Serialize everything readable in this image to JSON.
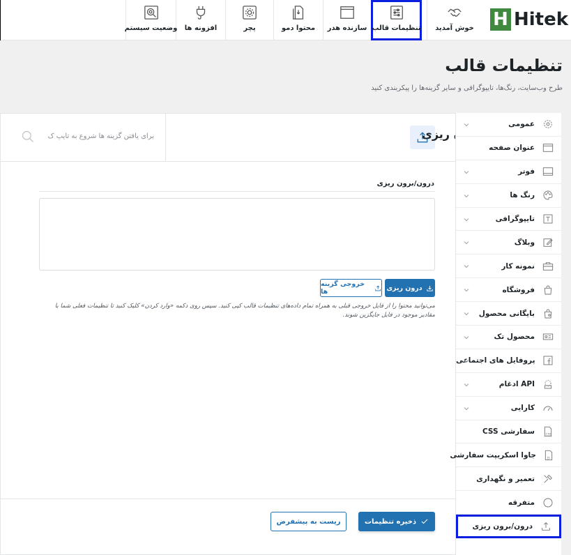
{
  "brand": {
    "name": "Hitek",
    "mark": "H",
    "color": "#3f8a3f"
  },
  "tabs": [
    {
      "label": "خوش آمدید",
      "icon": "handshake-icon"
    },
    {
      "label": "تنظیمات قالب",
      "icon": "sliders-icon",
      "active": true
    },
    {
      "label": "سازنده هدر",
      "icon": "layout-icon"
    },
    {
      "label": "محتوا دمو",
      "icon": "document-icon"
    },
    {
      "label": "پچر",
      "icon": "gear-box-icon"
    },
    {
      "label": "افزونه ها",
      "icon": "plug-icon"
    },
    {
      "label": "وضعیت سیستم",
      "icon": "search-gear-icon"
    }
  ],
  "page": {
    "title": "تنظیمات قالب",
    "description": "طرح وب‌سایت، رنگ‌ها، تایپوگرافی و سایر گزینه‌ها را پیکربندی کنید"
  },
  "sidebar": {
    "items": [
      {
        "label": "عمومی",
        "icon": "gear-icon",
        "has_children": true
      },
      {
        "label": "عنوان صفحه",
        "icon": "window-icon",
        "has_children": false
      },
      {
        "label": "فوتر",
        "icon": "footer-icon",
        "has_children": true
      },
      {
        "label": "رنگ ها",
        "icon": "palette-icon",
        "has_children": true
      },
      {
        "label": "تایپوگرافی",
        "icon": "typography-icon",
        "has_children": true
      },
      {
        "label": "وبلاگ",
        "icon": "edit-icon",
        "has_children": true
      },
      {
        "label": "نمونه کار",
        "icon": "briefcase-icon",
        "has_children": true
      },
      {
        "label": "فروشگاه",
        "icon": "bag-icon",
        "has_children": true
      },
      {
        "label": "بایگانی محصول",
        "icon": "archive-icon",
        "has_children": true
      },
      {
        "label": "محصول تک",
        "icon": "product-icon",
        "has_children": true
      },
      {
        "label": "پروفایل های اجتماعی",
        "icon": "facebook-icon",
        "has_children": true
      },
      {
        "label": "ادغام API",
        "icon": "api-icon",
        "has_children": true
      },
      {
        "label": "کارایی",
        "icon": "gauge-icon",
        "has_children": true
      },
      {
        "label": "CSS سفارشی",
        "icon": "css-icon",
        "has_children": false
      },
      {
        "label": "جاوا اسکریپت سفارشی",
        "icon": "js-icon",
        "has_children": false
      },
      {
        "label": "تعمیر و نگهداری",
        "icon": "tools-icon",
        "has_children": false
      },
      {
        "label": "متفرقه",
        "icon": "dots-icon",
        "has_children": false
      },
      {
        "label": "درون/برون ریزی",
        "icon": "upload-icon",
        "has_children": false,
        "active": true
      }
    ]
  },
  "content": {
    "section_title": "درون/برون ریزی",
    "search_placeholder": "برای یافتن گزینه ها شروع به تایپ ک",
    "field_label": "درون/برون ریزی",
    "textarea_value": "",
    "import_label": "درون ریزی",
    "export_label": "خروجی گزینه ها",
    "help_text": "می‌توانید محتوا را از فایل خروجی قبلی به همراه تمام داده‌های تنظیمات قالب کپی کنید. سپس روی دکمه «وارد کردن» کلیک کنید تا تنظیمات فعلی شما با مقادیر موجود در فایل جایگزین شوند."
  },
  "footer": {
    "save_label": "ذخیره تنظیمات",
    "reset_label": "ریست به پیشفرض"
  },
  "colors": {
    "accent": "#2271b1",
    "highlight": "#0a1ee0"
  }
}
